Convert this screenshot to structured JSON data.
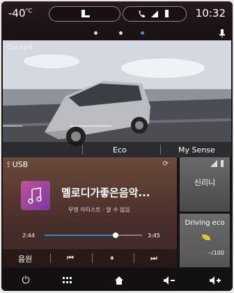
{
  "status_bar": {
    "temperature": "-40",
    "temperature_unit": "°C",
    "clock": "10:32"
  },
  "page_indicator": {
    "count": 3,
    "active_index": 2
  },
  "car_widget": {
    "title": "Cockpit",
    "tabs": [
      "Eco",
      "My Sense"
    ]
  },
  "media_widget": {
    "source_label": "USB",
    "track_title": "멜로디가좋은음악...",
    "artist_line": "무명 아티스트 · 알 수 없음",
    "time_elapsed": "2:44",
    "time_total": "3:45",
    "progress_fraction": 0.73,
    "source_button_label": "음원"
  },
  "signal_widget": {
    "name": "신리니"
  },
  "eco_widget": {
    "title": "Driving eco",
    "score": "--/100"
  },
  "colors": {
    "accent": "#3d8ee0",
    "eco_leaf": "#d9d01e"
  },
  "icons": {
    "status": [
      "seat-icon",
      "phone-icon",
      "signal-icon",
      "battery-icon"
    ],
    "media_controls": [
      "previous-icon",
      "pause-icon",
      "next-icon"
    ],
    "nav": [
      "power-icon",
      "apps-icon",
      "home-icon",
      "volume-down-icon",
      "volume-up-icon"
    ]
  }
}
